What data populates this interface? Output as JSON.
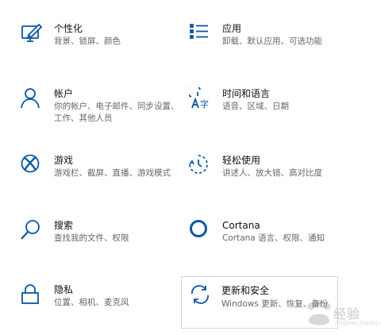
{
  "colors": {
    "accent": "#0a56a6",
    "title": "#111111",
    "description": "#666666",
    "selected_border": "#d6d6d6"
  },
  "settings": [
    {
      "icon": "personalization-icon",
      "title": "个性化",
      "desc": "背景、锁屏、颜色"
    },
    {
      "icon": "apps-icon",
      "title": "应用",
      "desc": "卸载、默认应用、可选功能"
    },
    {
      "icon": "accounts-icon",
      "title": "帐户",
      "desc": "你的帐户、电子邮件、同步设置、工作、其他人员"
    },
    {
      "icon": "time-language-icon",
      "title": "时间和语言",
      "desc": "语音、区域、日期"
    },
    {
      "icon": "xbox-icon",
      "title": "游戏",
      "desc": "游戏栏、截屏、直播、游戏模式"
    },
    {
      "icon": "ease-of-access-icon",
      "title": "轻松使用",
      "desc": "讲述人、放大镜、高对比度"
    },
    {
      "icon": "search-icon",
      "title": "搜索",
      "desc": "查找我的文件、权限"
    },
    {
      "icon": "cortana-icon",
      "title": "Cortana",
      "desc": "Cortana 语言、权限、通知"
    },
    {
      "icon": "privacy-icon",
      "title": "隐私",
      "desc": "位置、相机、麦克风"
    },
    {
      "icon": "update-security-icon",
      "title": "更新和安全",
      "desc": "Windows 更新、恢复、备份"
    }
  ],
  "watermark": {
    "text": "经验",
    "sub": "jingyan.baidu.com"
  }
}
